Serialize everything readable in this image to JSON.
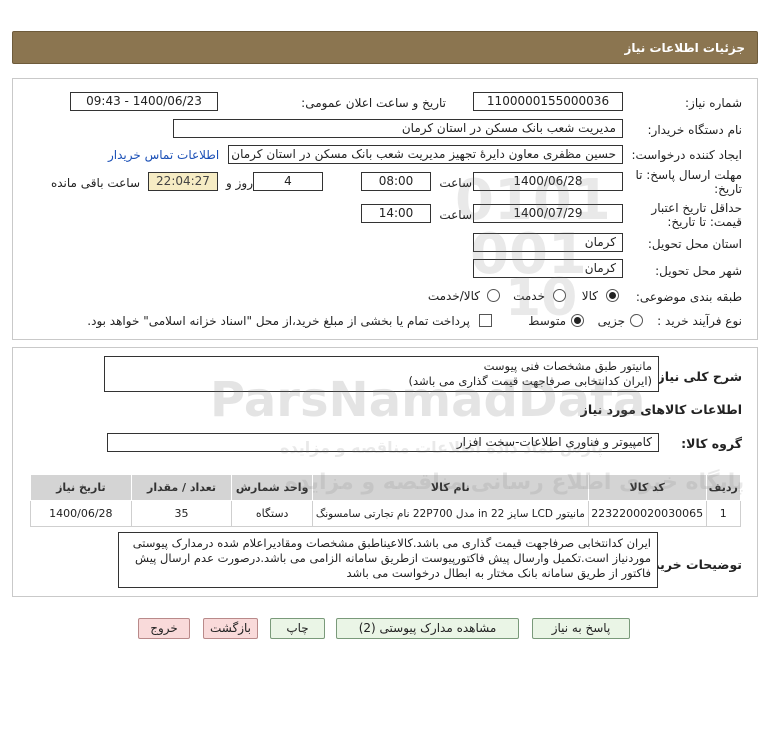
{
  "header": {
    "title": "جزئیات اطلاعات نیاز"
  },
  "form": {
    "need_number_label": "شماره نیاز:",
    "need_number": "1100000155000036",
    "announce_label": "تاریخ و ساعت اعلان عمومی:",
    "announce_value": "1400/06/23 - 09:43",
    "buyer_label": "نام دستگاه خریدار:",
    "buyer_value": "مدیریت شعب بانک مسکن در استان کرمان",
    "creator_label": "ایجاد کننده درخواست:",
    "creator_value": "حسین  مظفری  معاون دایرهٔ تجهیز مدیریت شعب بانک مسکن در استان کرمان",
    "contact_link": "اطلاعات تماس خریدار",
    "deadline_label_1": "مهلت ارسال پاسخ: تا",
    "deadline_label_2": "تاریخ:",
    "deadline_date": "1400/06/28",
    "deadline_time_label": "ساعت",
    "deadline_time": "08:00",
    "days_value": "4",
    "days_label": "روز و",
    "remaining_time": "22:04:27",
    "remaining_label": "ساعت باقی مانده",
    "validity_label_1": "حداقل تاریخ اعتبار",
    "validity_label_2": "قیمت: تا تاریخ:",
    "validity_date": "1400/07/29",
    "validity_time_label": "ساعت",
    "validity_time": "14:00",
    "province_label": "استان محل تحویل:",
    "province_value": "کرمان",
    "city_label": "شهر محل تحویل:",
    "city_value": "کرمان",
    "category_label": "طبقه بندی موضوعی:",
    "category_options": [
      "کالا",
      "خدمت",
      "کالا/خدمت"
    ],
    "category_selected": "کالا",
    "process_label": "نوع فرآیند خرید :",
    "process_options": [
      "جزیی",
      "متوسط"
    ],
    "process_selected": "متوسط",
    "payment_note": "پرداخت تمام یا بخشی از مبلغ خرید،از محل \"اسناد خزانه اسلامی\" خواهد بود."
  },
  "description": {
    "label": "شرح کلی نیاز:",
    "line1": "مانیتور طبق مشخصات فنی پیوست",
    "line2": "(ایران کدانتخابی صرفاجهت قیمت گذاری می باشد)"
  },
  "goods": {
    "section_title": "اطلاعات کالاهای مورد نیاز",
    "group_label": "گروه کالا:",
    "group_value": "کامپیوتر و فناوری اطلاعات-سخت افزار",
    "columns": [
      "ردیف",
      "کد کالا",
      "نام کالا",
      "واحد شمارش",
      "تعداد / مقدار",
      "تاریخ نیاز"
    ],
    "rows": [
      [
        "1",
        "2232200020030065",
        "مانیتور LCD سایز 22 in مدل 22P700 نام تجارتی سامسونگ",
        "دستگاه",
        "35",
        "1400/06/28"
      ]
    ]
  },
  "buyer_notes": {
    "label": "توضیحات خریدار:",
    "text": "ایران کدانتخابی صرفاجهت قیمت گذاری می باشد.کالاعیناطبق مشخصات ومقادیراعلام شده درمدارک پیوستی موردنیاز است.تکمیل وارسال پیش فاکتورپیوست ازطریق سامانه الزامی می باشد.درصورت عدم ارسال پیش فاکتور از طریق سامانه بانک مختار به ابطال درخواست می باشد"
  },
  "buttons": {
    "reply": "پاسخ به نیاز",
    "attachments": "مشاهده مدارک پیوستی (2)",
    "print": "چاپ",
    "back": "بازگشت",
    "exit": "خروج"
  },
  "watermark": {
    "brand": "ParsNamadData",
    "tagline": "پایگاه خبری اطلاع رسانی مناقصه و مزایده",
    "tagline2": "پارس نماد داده اطلاعات مناقصه و مزایده",
    "num1": "0101",
    "num2": "001",
    "num3": "10"
  },
  "colors": {
    "title_bar": "#8b7550",
    "button_green": "#eaf5e6",
    "button_red": "#f9dada",
    "link": "#1a4fb6",
    "remaining_bg": "#f6ecc4"
  }
}
